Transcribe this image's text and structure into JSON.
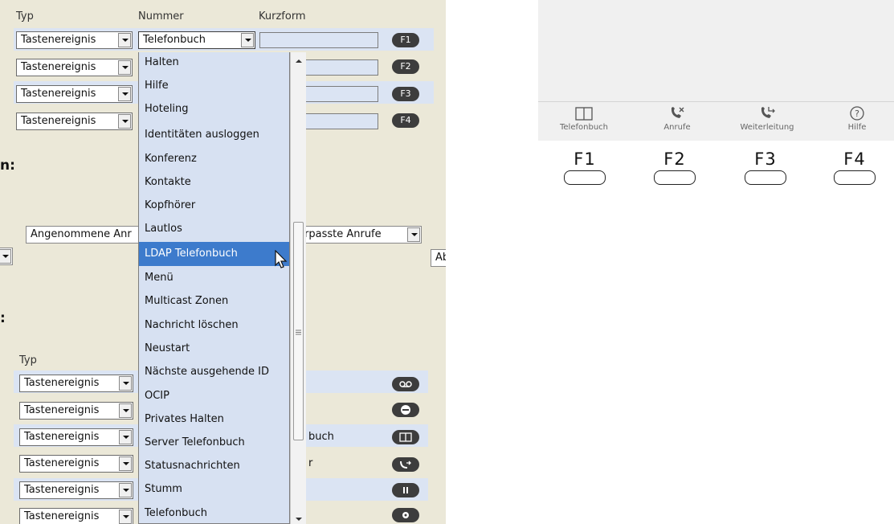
{
  "headers": {
    "typ": "Typ",
    "nummer": "Nummer",
    "kurzform": "Kurzform"
  },
  "top_rows": [
    {
      "type": "Tastenereignis",
      "number": "Telefonbuch",
      "key": "F1"
    },
    {
      "type": "Tastenereignis",
      "key": "F2"
    },
    {
      "type": "Tastenereignis",
      "key": "F3"
    },
    {
      "type": "Tastenereignis",
      "key": "F4"
    }
  ],
  "section1_label": "n:",
  "section2_label": ":",
  "middle": {
    "sel1": "Angenommene Anr",
    "sel2": "rpasste Anrufe",
    "sel3": "Ab"
  },
  "bottom_header": "Typ",
  "bottom_rows": [
    {
      "type": "Tastenereignis",
      "number": ""
    },
    {
      "type": "Tastenereignis",
      "number": ""
    },
    {
      "type": "Tastenereignis",
      "number": "buch"
    },
    {
      "type": "Tastenereignis",
      "number": "r"
    },
    {
      "type": "Tastenereignis",
      "number": ""
    },
    {
      "type": "Tastenereignis",
      "number": ""
    }
  ],
  "dropdown_options": [
    "Halten",
    "Hilfe",
    "Hoteling",
    "Identitäten ausloggen",
    "Konferenz",
    "Kontakte",
    "Kopfhörer",
    "Lautlos",
    "LDAP Telefonbuch",
    "Menü",
    "Multicast Zonen",
    "Nachricht löschen",
    "Neustart",
    "Nächste ausgehende ID",
    "OCIP",
    "Privates Halten",
    "Server Telefonbuch",
    "Statusnachrichten",
    "Stumm",
    "Telefonbuch"
  ],
  "highlighted_option": "LDAP Telefonbuch",
  "softkeys": [
    {
      "label": "Telefonbuch",
      "icon": "book-icon"
    },
    {
      "label": "Anrufe",
      "icon": "calls-icon"
    },
    {
      "label": "Weiterleitung",
      "icon": "forward-icon"
    },
    {
      "label": "Hilfe",
      "icon": "help-icon"
    }
  ],
  "fkeys": [
    "F1",
    "F2",
    "F3",
    "F4"
  ]
}
